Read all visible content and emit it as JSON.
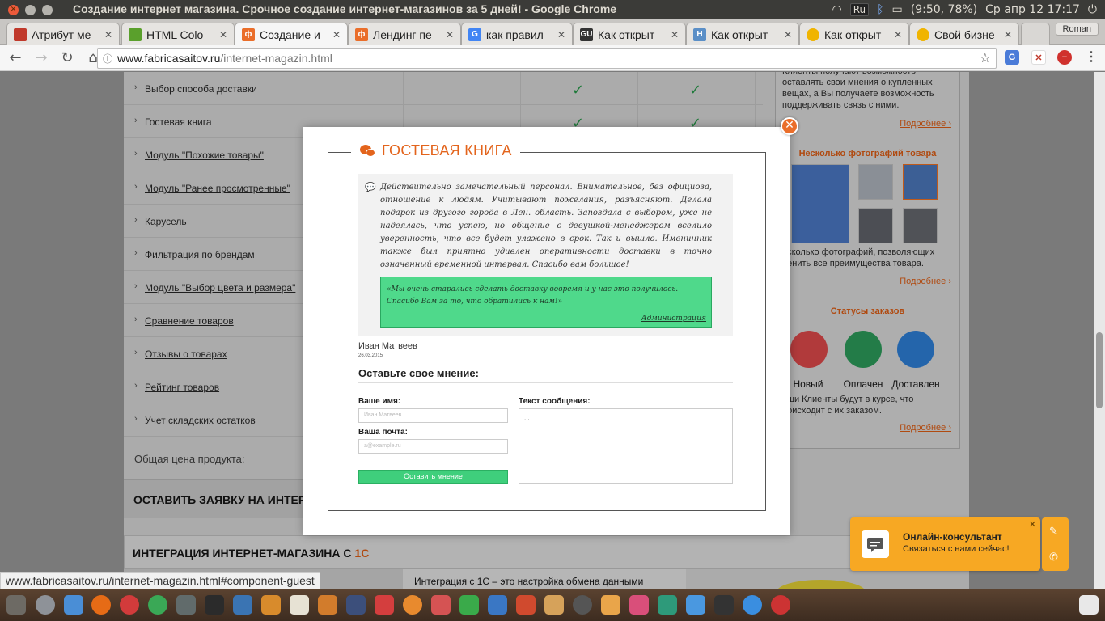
{
  "window": {
    "title": "Создание интернет магазина. Срочное создание интернет-магазинов за 5 дней! - Google Chrome"
  },
  "tray": {
    "lang": "Ru",
    "battery": "(9:50, 78%)",
    "clock": "Ср апр 12 17:17",
    "user": "Roman"
  },
  "tabs": [
    {
      "label": "Атрибут ме",
      "fav_color": "#c0392b",
      "fav_glyph": ""
    },
    {
      "label": "HTML Colo",
      "fav_color": "#5aa02c",
      "fav_glyph": ""
    },
    {
      "label": "Создание и",
      "fav_color": "#ea6e2a",
      "fav_glyph": "ф"
    },
    {
      "label": "Лендинг пе",
      "fav_color": "#ea6e2a",
      "fav_glyph": "ф"
    },
    {
      "label": "как правил",
      "fav_color": "#4285f4",
      "fav_glyph": "G"
    },
    {
      "label": "Как открыт",
      "fav_color": "#333333",
      "fav_glyph": "GU"
    },
    {
      "label": "Как открыт",
      "fav_color": "#5b8fc7",
      "fav_glyph": "H"
    },
    {
      "label": "Как открыт",
      "fav_color": "#f0b400",
      "fav_glyph": ""
    },
    {
      "label": "Свой бизне",
      "fav_color": "#f0b400",
      "fav_glyph": ""
    }
  ],
  "address": {
    "host": "www.fabricasaitov.ru",
    "path": "/internet-magazin.html"
  },
  "status_url": "www.fabricasaitov.ru/internet-magazin.html#component-guest",
  "features": [
    {
      "label": "Выбор способа доставки",
      "link": false,
      "check": true
    },
    {
      "label": "Гостевая книга",
      "link": false,
      "check": true
    },
    {
      "label": "Модуль \"Похожие товары\"",
      "link": true,
      "check": false
    },
    {
      "label": "Модуль \"Ранее просмотренные\"",
      "link": true,
      "check": false
    },
    {
      "label": "Карусель",
      "link": false,
      "check": false
    },
    {
      "label": "Фильтрация по брендам",
      "link": false,
      "check": false
    },
    {
      "label": "Модуль \"Выбор цвета и размера\"",
      "link": true,
      "check": false
    },
    {
      "label": "Сравнение товаров",
      "link": true,
      "check": false
    },
    {
      "label": "Отзывы о товарах",
      "link": true,
      "check": false
    },
    {
      "label": "Рейтинг товаров",
      "link": true,
      "check": false
    },
    {
      "label": "Учет складских остатков",
      "link": false,
      "check": false
    }
  ],
  "total_label": "Общая цена продукта:",
  "order_label": "ОСТАВИТЬ ЗАЯВКУ НА ИНТЕРН",
  "integration": {
    "title": "ИНТЕГРАЦИЯ ИНТЕРНЕТ-МАГАЗИНА С ",
    "accent": "1С",
    "text": "Интеграция с 1С – это настройка обмена данными"
  },
  "sidebar": {
    "top_text": "Клиенты получают возможность оставлять свои мнения о купленных вещах, а Вы получаете возможность поддерживать связь с ними.",
    "more": "Подробнее ›",
    "photos_title": "Несколько фотографий товара",
    "photos_text": "есколько фотографий, позволяющих ценить все преимущества товара.",
    "statuses_title": "Статусы заказов",
    "statuses": [
      {
        "label": "Новый",
        "color": "#c0393b",
        "icon": "New"
      },
      {
        "label": "Оплачен",
        "color": "#1f9a4e",
        "icon": "₽"
      },
      {
        "label": "Доставлен",
        "color": "#1f6fbf",
        "icon": "👍"
      }
    ],
    "statuses_text": "аши Клиенты будут в курсе, что роисходит с их заказом."
  },
  "modal": {
    "title": "ГОСТЕВАЯ КНИГА",
    "review_text": "Действительно замечательный персонал. Внимательное, без официоза, отношение к людям. Учитывают пожелания, разъясняют. Делала подарок из другого города в Лен. область. Запоздала с выбором, уже не надеялась, что успею, но общение с девушкой-менеджером вселило уверенность, что все будет улажено в срок. Так и вышло. Именинник также был приятно удивлен оперативности доставки в точно означенный временной интервал. Спасибо вам большое!",
    "reply_text": "«Мы очень старались сделать доставку вовремя и у нас это получилось. Спасибо Вам за то, что обратились к нам!»",
    "reply_author": "Администрация",
    "author": "Иван Матвеев",
    "date": "26.03.2015",
    "form_title": "Оставьте свое мнение:",
    "name_label": "Ваше имя:",
    "name_placeholder": "Иван Матвеев",
    "email_label": "Ваша почта:",
    "email_placeholder": "a@example.ru",
    "message_label": "Текст сообщения:",
    "message_placeholder": "...",
    "submit": "Оставить мнение"
  },
  "consultant": {
    "title": "Онлайн-консультант",
    "subtitle": "Связаться с нами сейчас!"
  },
  "colors": {
    "accent": "#e3641c",
    "green": "#4fd98b",
    "consult": "#f7a823"
  }
}
